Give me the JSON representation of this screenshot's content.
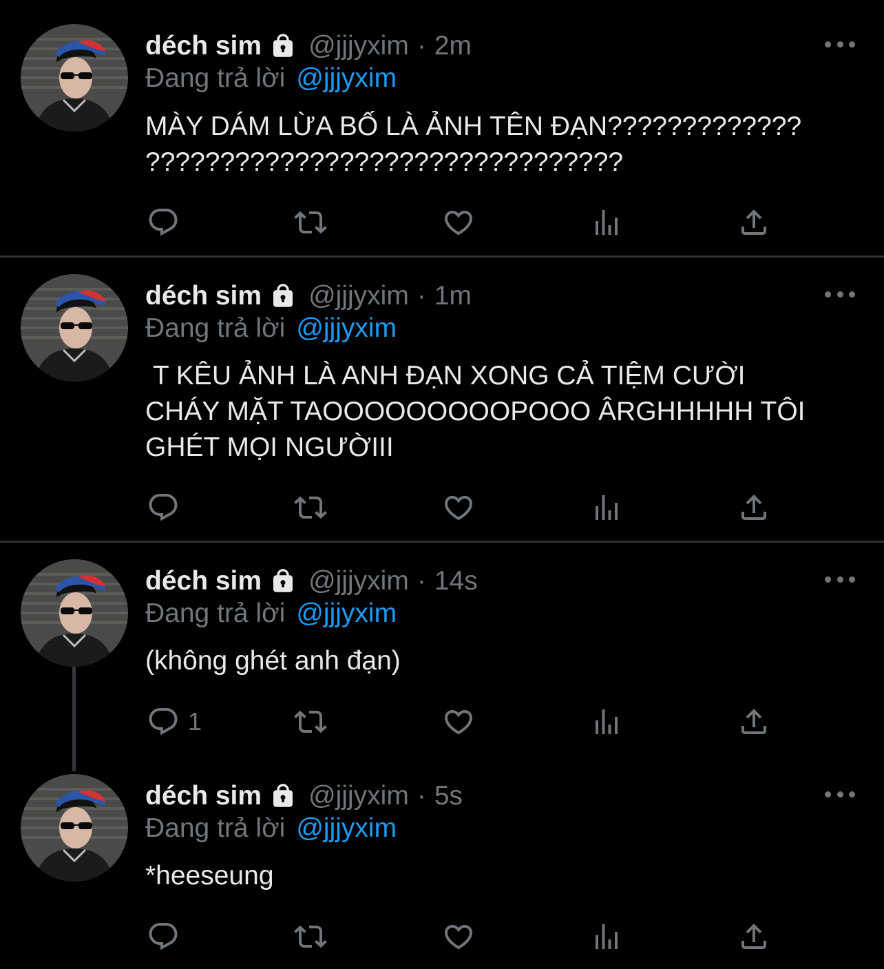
{
  "tweets": [
    {
      "name": "déch sim",
      "handle": "@jjjyxim",
      "time": "2m",
      "replying_label": "Đang trả lời",
      "replying_to": "@jjjyxim",
      "text": "MÀY DÁM LỪA BỐ LÀ ẢNH TÊN ĐẠN?????????????\n????????????????????????????????",
      "reply_count": ""
    },
    {
      "name": "déch sim",
      "handle": "@jjjyxim",
      "time": "1m",
      "replying_label": "Đang trả lời",
      "replying_to": "@jjjyxim",
      "text": " T KÊU ẢNH LÀ ANH ĐẠN XONG CẢ TIỆM CƯỜI\nCHÁY MẶT TAOOOOOOOOOPOOO ÂRGHHHHH TÔI\nGHÉT MỌI NGƯỜIII",
      "reply_count": ""
    },
    {
      "name": "déch sim",
      "handle": "@jjjyxim",
      "time": "14s",
      "replying_label": "Đang trả lời",
      "replying_to": "@jjjyxim",
      "text": "(không ghét anh đạn)",
      "reply_count": "1"
    },
    {
      "name": "déch sim",
      "handle": "@jjjyxim",
      "time": "5s",
      "replying_label": "Đang trả lời",
      "replying_to": "@jjjyxim",
      "text": "*heeseung",
      "reply_count": ""
    }
  ],
  "icons": {
    "reply": "reply-icon",
    "retweet": "retweet-icon",
    "like": "heart-icon",
    "views": "views-icon",
    "share": "share-icon",
    "more": "more-icon",
    "lock": "lock-icon"
  },
  "colors": {
    "background": "#000000",
    "text": "#e7e9ea",
    "muted": "#71767b",
    "accent": "#1d9bf0",
    "divider": "#2f3336"
  }
}
